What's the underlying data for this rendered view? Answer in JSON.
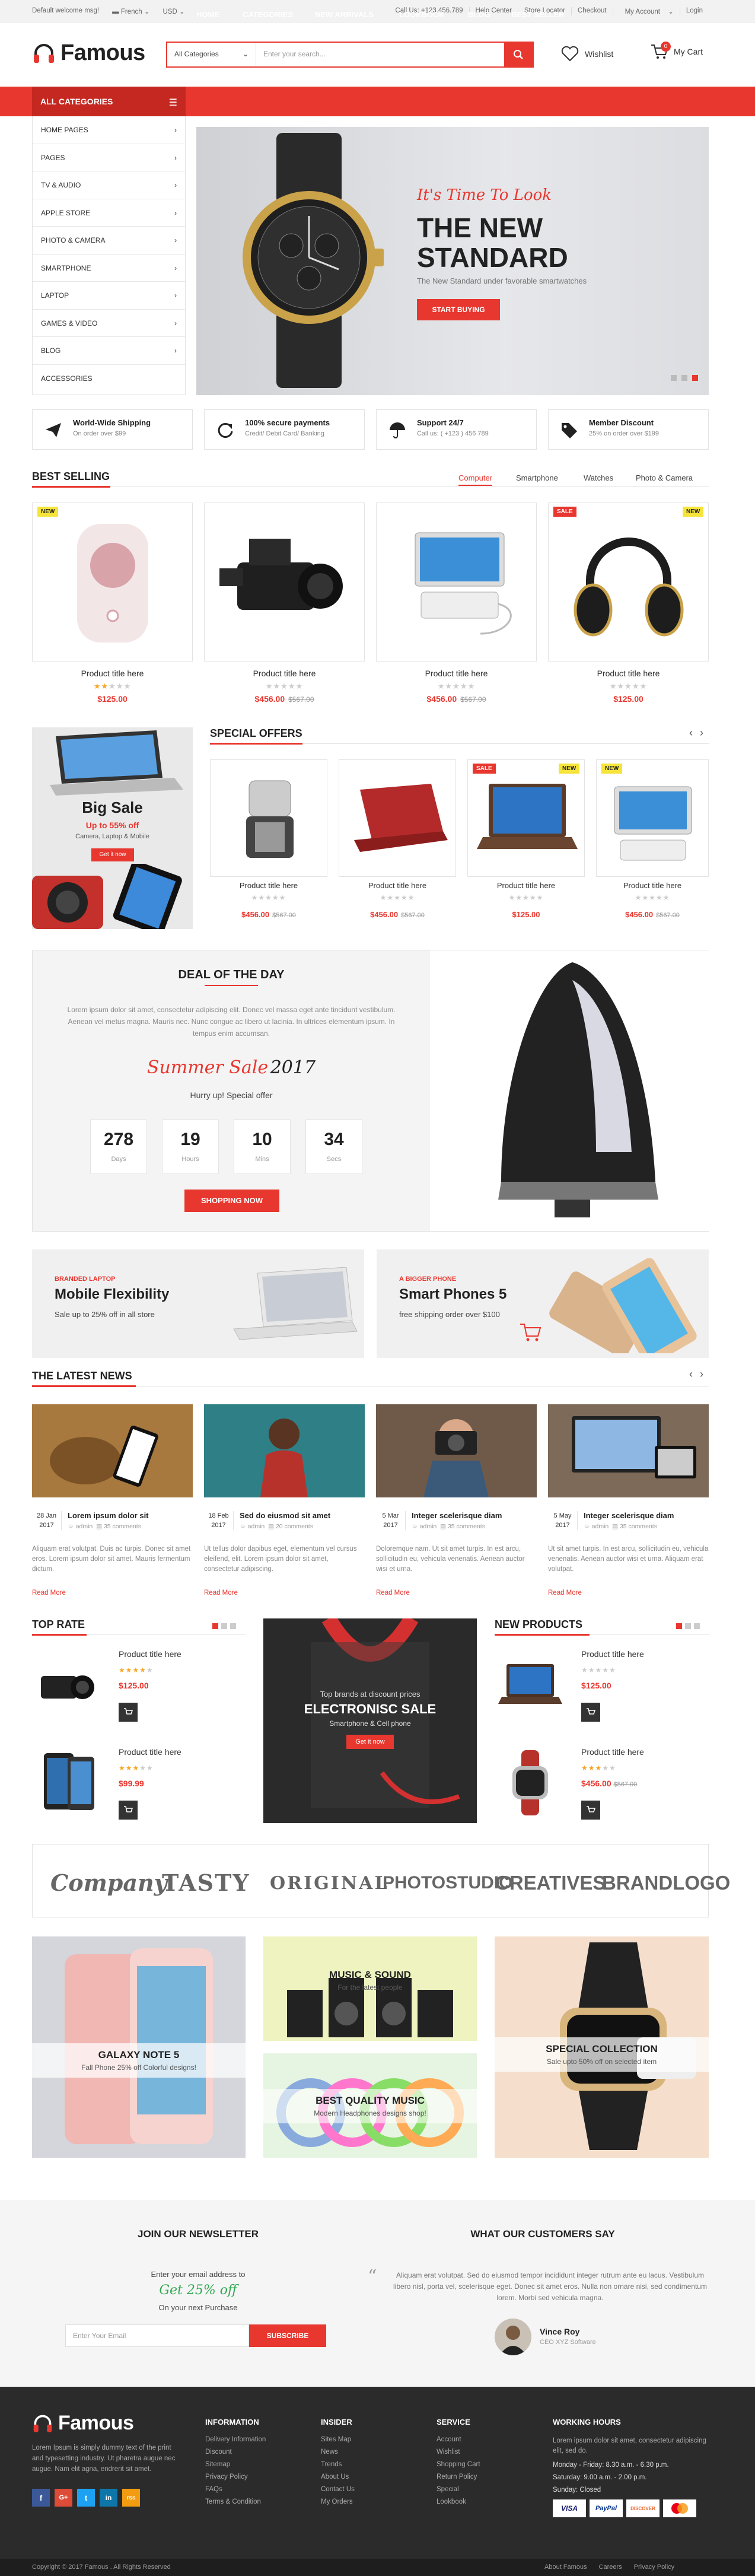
{
  "topbar": {
    "welcome": "Default welcome msg!",
    "language": "French",
    "currency": "USD",
    "links": [
      "Call Us: +123.456.789",
      "Help Center",
      "Store Locator",
      "Checkout",
      "My Account",
      "Login"
    ]
  },
  "header": {
    "logo": "Famous",
    "search_category": "All Categories",
    "search_placeholder": "Enter your search...",
    "wishlist": "Wishlist",
    "cart": "My Cart",
    "cart_count": "0"
  },
  "nav": {
    "all_categories": "ALL CATEGORIES",
    "items": [
      "Home",
      "Categories",
      "New Arrivals",
      "Lookbook",
      "Blog",
      "Best Seller"
    ]
  },
  "sidebar": {
    "items": [
      "Home Pages",
      "Pages",
      "TV & Audio",
      "Apple Store",
      "Photo & Camera",
      "Smartphone",
      "Laptop",
      "Games & Video",
      "Blog",
      "Accessories"
    ]
  },
  "hero": {
    "script": "It's Time To Look",
    "title_line1": "THE NEW",
    "title_line2": "STANDARD",
    "subtitle": "The New Standard under favorable smartwatches",
    "button": "START BUYING"
  },
  "features": [
    {
      "title": "World-Wide Shipping",
      "sub": "On order over $99"
    },
    {
      "title": "100% secure payments",
      "sub": "Credit/ Debit Card/ Banking"
    },
    {
      "title": "Support 24/7",
      "sub": "Call us: ( +123 ) 456 789"
    },
    {
      "title": "Member Discount",
      "sub": "25% on order over $199"
    }
  ],
  "best_selling": {
    "title": "BEST SELLING",
    "tabs": [
      "Computer",
      "Smartphone",
      "Watches",
      "Photo & Camera"
    ],
    "products": [
      {
        "title": "Product title here",
        "price": "$125.00",
        "old": "",
        "badge": "NEW"
      },
      {
        "title": "Product title here",
        "price": "$456.00",
        "old": "$567.00",
        "badge": ""
      },
      {
        "title": "Product title here",
        "price": "$456.00",
        "old": "$567.00",
        "badge": ""
      },
      {
        "title": "Product title here",
        "price": "$125.00",
        "old": "",
        "badge": "SALE",
        "badge2": "NEW"
      }
    ]
  },
  "promo_left": {
    "title": "Big Sale",
    "sub": "Up to 55% off",
    "desc": "Camera, Laptop & Mobile",
    "button": "Get it now"
  },
  "special_offers": {
    "title": "SPECIAL OFFERS",
    "products": [
      {
        "title": "Product title here",
        "price": "$456.00",
        "old": "$567.00",
        "badge": ""
      },
      {
        "title": "Product title here",
        "price": "$456.00",
        "old": "$567.00",
        "badge": ""
      },
      {
        "title": "Product title here",
        "price": "$125.00",
        "old": "",
        "badge": "SALE",
        "badge2": "NEW"
      },
      {
        "title": "Product title here",
        "price": "$456.00",
        "old": "$567.00",
        "badge": "NEW"
      }
    ]
  },
  "deal": {
    "title": "DEAL OF THE DAY",
    "text": "Lorem ipsum dolor sit amet, consectetur adipiscing elit. Donec vel massa eget ante tincidunt vestibulum. Aenean vel metus magna. Mauris nec. Nunc congue ac libero ut lacinia. In ultrices elementum ipsum. In tempus enim accumsan.",
    "sale_script": "Summer Sale",
    "sale_year": "2017",
    "hurry": "Hurry up! Special offer",
    "countdown": [
      {
        "n": "278",
        "l": "Days"
      },
      {
        "n": "19",
        "l": "Hours"
      },
      {
        "n": "10",
        "l": "Mins"
      },
      {
        "n": "34",
        "l": "Secs"
      }
    ],
    "button": "SHOPPING NOW"
  },
  "banners": [
    {
      "tag": "BRANDED LAPTOP",
      "title": "Mobile Flexibility",
      "sub": "Sale up to 25% off in all store"
    },
    {
      "tag": "A BIGGER PHONE",
      "title": "Smart  Phones 5",
      "sub": "free shipping order over $100"
    }
  ],
  "news": {
    "title": "THE LATEST NEWS",
    "items": [
      {
        "day": "28 Jan",
        "year": "2017",
        "title": "Lorem ipsum dolor sit",
        "author": "admin",
        "comments": "35 comments",
        "excerpt": "Aliquam erat volutpat. Duis ac turpis. Donec sit amet eros. Lorem ipsum dolor sit amet. Mauris fermentum dictum.",
        "more": "Read More"
      },
      {
        "day": "18 Feb",
        "year": "2017",
        "title": "Sed do eiusmod sit amet",
        "author": "admin",
        "comments": "20 comments",
        "excerpt": "Ut tellus dolor dapibus eget, elementum vel cursus eleifend, elit. Lorem ipsum dolor sit amet, consectetur adipiscing.",
        "more": "Read More"
      },
      {
        "day": "5 Mar",
        "year": "2017",
        "title": "Integer scelerisque diam",
        "author": "admin",
        "comments": "35 comments",
        "excerpt": "Doloremque nam. Ut sit amet turpis. In est arcu, sollicitudin eu, vehicula venenatis. Aenean auctor wisi et urna.",
        "more": "Read More"
      },
      {
        "day": "5 May",
        "year": "2017",
        "title": "Integer scelerisque diam",
        "author": "admin",
        "comments": "35 comments",
        "excerpt": "Ut sit amet turpis. In est arcu, sollicitudin eu, vehicula venenatis. Aenean auctor wisi et urna. Aliquam erat volutpat.",
        "more": "Read More"
      }
    ]
  },
  "top_rate": {
    "title": "TOP RATE",
    "products": [
      {
        "title": "Product title here",
        "price": "$125.00"
      },
      {
        "title": "Product title here",
        "price": "$99.99"
      }
    ]
  },
  "electronic_sale": {
    "kicker": "Top brands at discount prices",
    "title": "ELECTRONISC SALE",
    "sub": "Smartphone & Cell phone",
    "button": "Get it now"
  },
  "new_products": {
    "title": "NEW PRODUCTS",
    "products": [
      {
        "title": "Product title here",
        "price": "$125.00",
        "old": ""
      },
      {
        "title": "Product title here",
        "price": "$456.00",
        "old": "$567.00"
      }
    ]
  },
  "brands": [
    "Company",
    "TASTY",
    "ORIGINAL",
    "PHOTOSTUDIO",
    "CREATIVES",
    "BRANDLOGO"
  ],
  "collections": [
    {
      "title": "GALAXY NOTE 5",
      "sub": "Fall Phone 25% off Colorful designs!"
    },
    {
      "title": "MUSIC & SOUND",
      "sub": "For the latest people"
    },
    {
      "title": "BEST QUALITY MUSIC",
      "sub": "Modern Headphones designs shop!"
    },
    {
      "title": "SPECIAL COLLECTION",
      "sub": "Sale upto 50% off on selected item"
    }
  ],
  "newsletter": {
    "title": "JOIN OUR NEWSLETTER",
    "line1": "Enter your email address to",
    "line2": "Get 25% off",
    "line3": "On your next Purchase",
    "placeholder": "Enter Your Email",
    "button": "SUBSCRIBE"
  },
  "testimonial": {
    "title": "WHAT OUR CUSTOMERS SAY",
    "quote": "Aliquam erat volutpat. Sed do eiusmod tempor incididunt integer rutrum ante eu lacus. Vestibulum libero nisl, porta vel, scelerisque eget. Donec sit amet eros. Nulla non ornare nisi, sed condimentum lorem. Morbi sed vehicula magna.",
    "name": "Vince Roy",
    "role": "CEO XYZ Software"
  },
  "footer": {
    "about": "Lorem Ipsum is simply dummy text of the print and typesetting industry. Ut pharetra augue nec augue. Nam elit agna, endrerit sit amet.",
    "information": {
      "title": "INFORMATION",
      "items": [
        "Delivery Information",
        "Discount",
        "Sitemap",
        "Privacy Policy",
        "FAQs",
        "Terms & Condition"
      ]
    },
    "insider": {
      "title": "INSIDER",
      "items": [
        "Sites Map",
        "News",
        "Trends",
        "About Us",
        "Contact Us",
        "My Orders"
      ]
    },
    "service": {
      "title": "SERVICE",
      "items": [
        "Account",
        "Wishlist",
        "Shopping Cart",
        "Return Policy",
        "Special",
        "Lookbook"
      ]
    },
    "hours": {
      "title": "WORKING HOURS",
      "text": "Lorem ipsum dolor sit amet, consectetur adipiscing elit, sed do.",
      "mf": "Monday - Friday: 8.30 a.m. - 6.30 p.m.",
      "sat": "Saturday: 9.00 a.m. - 2.00 p.m.",
      "sun": "Sunday: Closed"
    },
    "payments": [
      "VISA",
      "PayPal",
      "DISCOVER",
      "MC"
    ],
    "social": [
      "f",
      "G+",
      "t",
      "in",
      "rss"
    ],
    "colors": {
      "facebook": "#3b5998",
      "google": "#dd4b39",
      "twitter": "#1da1f2",
      "linkedin": "#0e76a8",
      "rss": "#f39c12"
    }
  },
  "bottom": {
    "copyright": "Copyright © 2017 Famous . All Rights Reserved",
    "links": [
      "About Famous",
      "Careers",
      "Privacy Policy"
    ]
  },
  "colors": {
    "accent": "#e8372f",
    "dark": "#2b2b2b"
  }
}
